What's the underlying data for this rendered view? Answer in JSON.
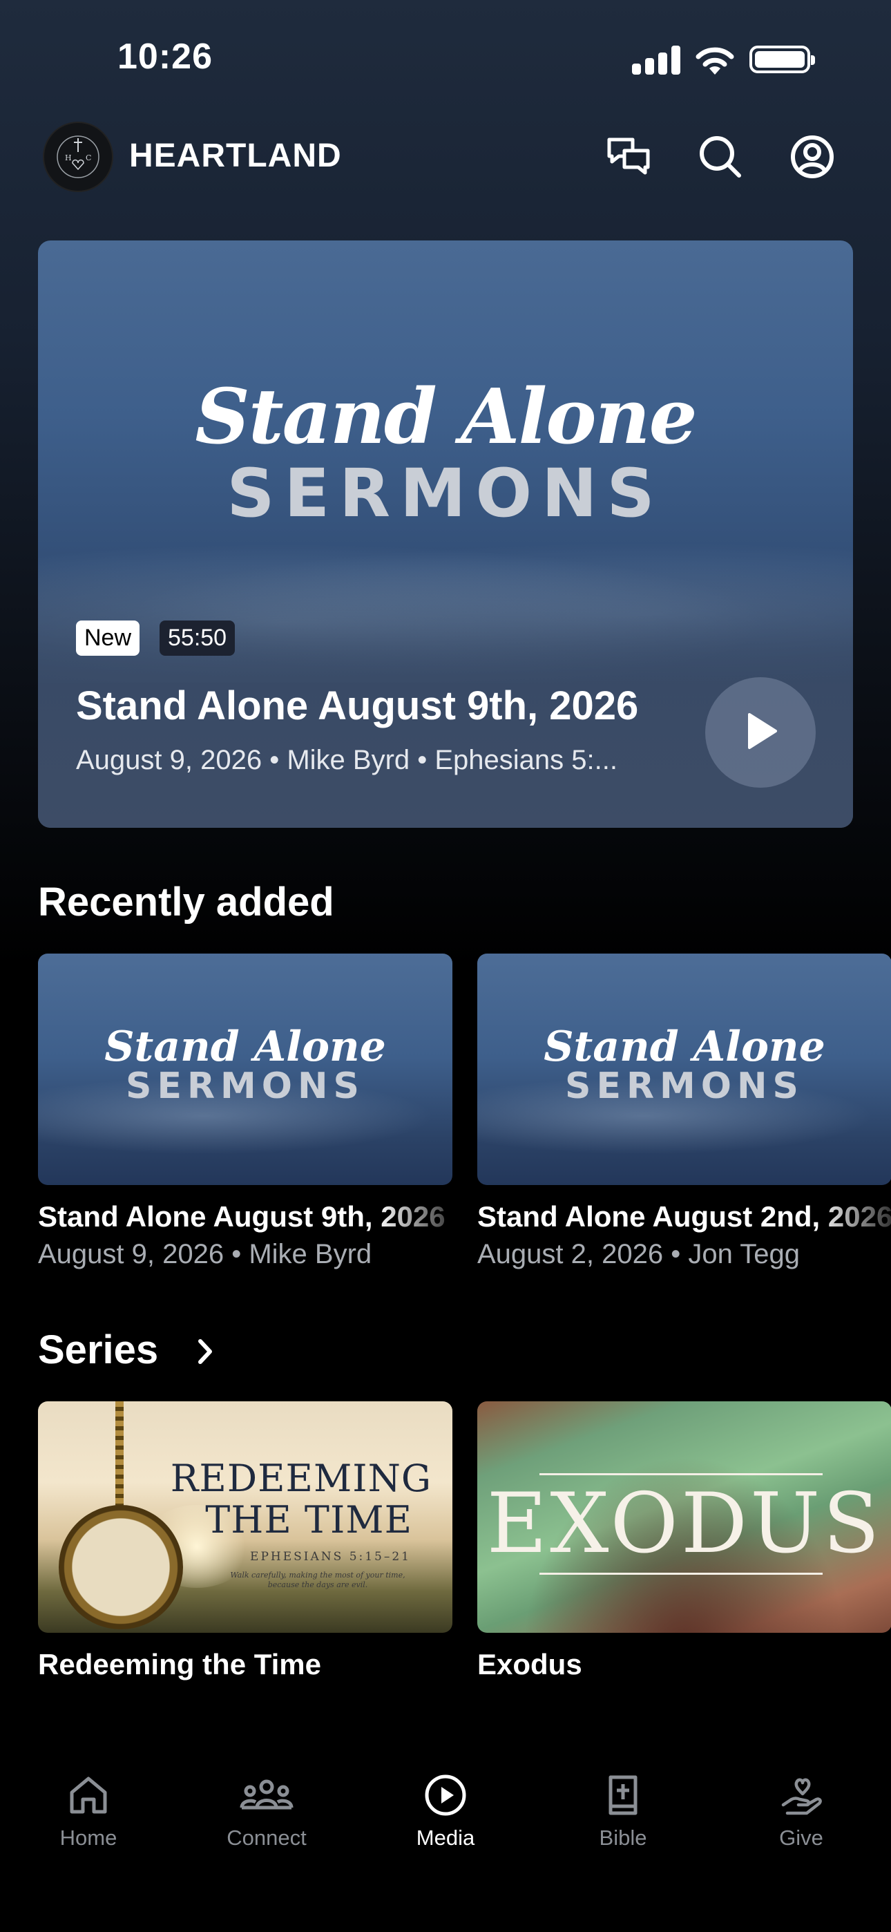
{
  "status_bar": {
    "time": "10:26"
  },
  "header": {
    "brand": "HEARTLAND",
    "logo_letters": "HC"
  },
  "hero": {
    "art_script": "Stand Alone",
    "art_caps": "SERMONS",
    "badge_new": "New",
    "duration": "55:50",
    "title": "Stand Alone August 9th, 2026",
    "meta": "August 9, 2026 • Mike Byrd • Ephesians 5:..."
  },
  "recently_added": {
    "heading": "Recently added",
    "items": [
      {
        "art_script": "Stand Alone",
        "art_caps": "SERMONS",
        "title": "Stand Alone August 9th, 2026",
        "subtitle": "August 9, 2026 • Mike Byrd"
      },
      {
        "art_script": "Stand Alone",
        "art_caps": "SERMONS",
        "title": "Stand Alone August 2nd, 2026",
        "subtitle": "August 2, 2026 • Jon Tegg"
      }
    ]
  },
  "series": {
    "heading": "Series",
    "items": [
      {
        "art_line1": "REDEEMING",
        "art_line2": "THE TIME",
        "art_ref": "EPHESIANS 5:15–21",
        "art_small": "Walk carefully, making the most of your time, because the days are evil.",
        "title": "Redeeming the Time"
      },
      {
        "art_title": "EXODUS",
        "title": "Exodus"
      }
    ]
  },
  "tabbar": {
    "items": [
      {
        "label": "Home",
        "icon": "home-icon"
      },
      {
        "label": "Connect",
        "icon": "people-icon"
      },
      {
        "label": "Media",
        "icon": "play-circle-icon",
        "active": true
      },
      {
        "label": "Bible",
        "icon": "bible-icon"
      },
      {
        "label": "Give",
        "icon": "heart-hand-icon"
      }
    ]
  },
  "colors": {
    "background": "#000000",
    "hero_blue": "#3e5f8b",
    "inactive_tab": "#8b8f95"
  }
}
